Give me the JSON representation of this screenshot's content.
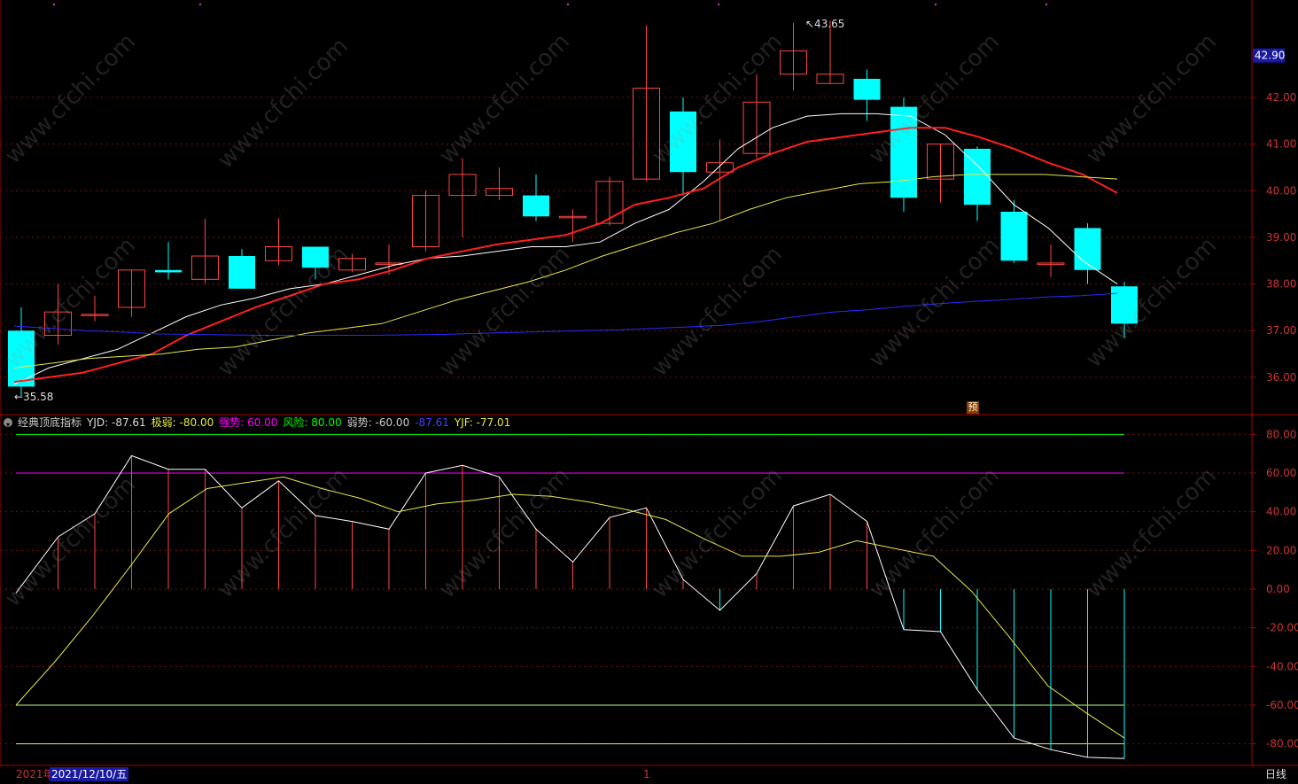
{
  "colors": {
    "background": "#000000",
    "up": "#ff4444",
    "down": "#00ffff",
    "grid": "#7a1010",
    "axis": "#aa0000",
    "ma5": "#ffffff",
    "ma10": "#ff2020",
    "ma20": "#e8e84a",
    "ma60": "#2a2aff",
    "yjd": "#ffffff",
    "yjf": "#e8e84a",
    "strong": "#ff00ff",
    "risk": "#00ff00",
    "weak": "#b0ff80"
  },
  "header": {
    "toggle_icon": "circle-arrow-icon",
    "indicator_name": "经典顶底指标",
    "yjd": "YJD: -87.61",
    "jiruo": "极弱: -80.00",
    "qiangshi": "强势: 60.00",
    "fengxian": "风险: 80.00",
    "ruoshi": "弱势: -60.00",
    "blue_value": "-87.61",
    "yjf": "YJF: -77.01"
  },
  "price_axis": {
    "current_price": "42.90",
    "ticks": [
      "42.00",
      "41.00",
      "40.00",
      "39.00",
      "38.00",
      "37.00",
      "36.00"
    ]
  },
  "indicator_axis": {
    "ticks": [
      "80.00",
      "60.00",
      "40.00",
      "20.00",
      "0.00",
      "-20.00",
      "-40.00",
      "-60.00",
      "-80.00"
    ]
  },
  "annotations": {
    "max_label": "43.65",
    "min_label": "35.58",
    "forecast_badge": "预"
  },
  "bottom": {
    "year_label": "2021年",
    "cursor_date": "2021/12/10/五",
    "month_marker": "1",
    "period_label": "日线"
  },
  "watermark_text": "www.cfchi.com",
  "chart_data": [
    {
      "type": "candlestick",
      "title": "",
      "ylim": [
        35.2,
        43.9
      ],
      "candles": [
        {
          "o": 37.0,
          "h": 37.5,
          "l": 35.6,
          "c": 35.8
        },
        {
          "o": 36.9,
          "h": 38.0,
          "l": 36.7,
          "c": 37.4
        },
        {
          "o": 37.35,
          "h": 37.75,
          "l": 37.2,
          "c": 37.35
        },
        {
          "o": 37.5,
          "h": 38.3,
          "l": 37.3,
          "c": 38.3
        },
        {
          "o": 38.3,
          "h": 38.9,
          "l": 38.1,
          "c": 38.25
        },
        {
          "o": 38.1,
          "h": 39.4,
          "l": 38.0,
          "c": 38.6
        },
        {
          "o": 38.6,
          "h": 38.75,
          "l": 37.9,
          "c": 37.9
        },
        {
          "o": 38.5,
          "h": 39.4,
          "l": 38.4,
          "c": 38.8
        },
        {
          "o": 38.8,
          "h": 38.8,
          "l": 38.1,
          "c": 38.35
        },
        {
          "o": 38.3,
          "h": 38.65,
          "l": 38.25,
          "c": 38.55
        },
        {
          "o": 38.45,
          "h": 38.85,
          "l": 38.2,
          "c": 38.45
        },
        {
          "o": 38.8,
          "h": 40.0,
          "l": 38.7,
          "c": 39.9
        },
        {
          "o": 39.9,
          "h": 40.7,
          "l": 39.0,
          "c": 40.35
        },
        {
          "o": 39.9,
          "h": 40.5,
          "l": 39.8,
          "c": 40.05
        },
        {
          "o": 39.9,
          "h": 40.35,
          "l": 39.35,
          "c": 39.45
        },
        {
          "o": 39.45,
          "h": 39.6,
          "l": 38.9,
          "c": 39.45
        },
        {
          "o": 39.3,
          "h": 40.3,
          "l": 39.25,
          "c": 40.2
        },
        {
          "o": 40.25,
          "h": 43.55,
          "l": 40.2,
          "c": 42.2
        },
        {
          "o": 41.7,
          "h": 42.0,
          "l": 39.9,
          "c": 40.4
        },
        {
          "o": 40.4,
          "h": 41.1,
          "l": 39.35,
          "c": 40.6
        },
        {
          "o": 40.8,
          "h": 42.5,
          "l": 40.7,
          "c": 41.9
        },
        {
          "o": 42.5,
          "h": 43.6,
          "l": 42.15,
          "c": 43.0
        },
        {
          "o": 42.3,
          "h": 43.65,
          "l": 42.3,
          "c": 42.5
        },
        {
          "o": 42.4,
          "h": 42.6,
          "l": 41.5,
          "c": 41.95
        },
        {
          "o": 41.8,
          "h": 42.0,
          "l": 39.55,
          "c": 39.85
        },
        {
          "o": 40.25,
          "h": 41.0,
          "l": 39.75,
          "c": 41.0
        },
        {
          "o": 40.9,
          "h": 40.95,
          "l": 39.35,
          "c": 39.7
        },
        {
          "o": 39.55,
          "h": 39.8,
          "l": 38.45,
          "c": 38.5
        },
        {
          "o": 38.45,
          "h": 38.85,
          "l": 38.15,
          "c": 38.45
        },
        {
          "o": 39.2,
          "h": 39.3,
          "l": 38.0,
          "c": 38.3
        },
        {
          "o": 37.95,
          "h": 38.05,
          "l": 36.85,
          "c": 37.15
        }
      ],
      "ma_series": [
        {
          "key": "ma5",
          "values": [
            35.85,
            36.2,
            36.4,
            36.6,
            36.95,
            37.3,
            37.55,
            37.7,
            37.9,
            38.0,
            38.2,
            38.4,
            38.55,
            38.6,
            38.7,
            38.8,
            38.8,
            38.9,
            39.3,
            39.6,
            40.2,
            40.9,
            41.35,
            41.6,
            41.65,
            41.65,
            41.6,
            41.2,
            40.5,
            39.7,
            39.2,
            38.5,
            38.0
          ]
        },
        {
          "key": "ma10",
          "values": [
            35.9,
            36.0,
            36.1,
            36.3,
            36.5,
            36.9,
            37.2,
            37.5,
            37.75,
            38.0,
            38.1,
            38.3,
            38.55,
            38.7,
            38.85,
            38.95,
            39.05,
            39.3,
            39.7,
            39.85,
            40.05,
            40.5,
            40.8,
            41.05,
            41.15,
            41.25,
            41.35,
            41.35,
            41.15,
            40.9,
            40.6,
            40.35,
            39.95
          ]
        },
        {
          "key": "ma20",
          "values": [
            36.2,
            36.3,
            36.4,
            36.45,
            36.5,
            36.6,
            36.65,
            36.8,
            36.95,
            37.05,
            37.15,
            37.4,
            37.65,
            37.85,
            38.05,
            38.3,
            38.6,
            38.85,
            39.1,
            39.3,
            39.6,
            39.85,
            40.0,
            40.15,
            40.2,
            40.3,
            40.35,
            40.35,
            40.35,
            40.3,
            40.25
          ]
        },
        {
          "key": "ma60",
          "values": [
            37.1,
            37.05,
            37.0,
            36.97,
            36.93,
            36.92,
            36.91,
            36.9,
            36.9,
            36.9,
            36.9,
            36.91,
            36.92,
            36.94,
            36.96,
            36.98,
            37.0,
            37.02,
            37.05,
            37.08,
            37.12,
            37.2,
            37.3,
            37.4,
            37.45,
            37.52,
            37.58,
            37.63,
            37.67,
            37.72,
            37.75,
            37.8
          ]
        }
      ]
    },
    {
      "type": "line",
      "title": "经典顶底指标",
      "ylim": [
        -88,
        88
      ],
      "levels": {
        "fengxian": 80,
        "qiangshi": 60,
        "ruoshi": -60,
        "jiruo": -80
      },
      "yjd": [
        -2,
        27,
        39,
        69,
        62,
        62,
        42,
        56,
        38,
        35,
        31,
        60,
        64,
        58,
        31,
        14,
        37,
        42,
        5,
        -11,
        8,
        43,
        49,
        35,
        -21,
        -22,
        -52,
        -77,
        -83,
        -87,
        -87.61
      ],
      "yjf": [
        -60,
        -38,
        -14,
        12,
        39,
        52,
        55,
        58,
        52,
        47,
        40,
        44,
        46,
        49,
        48,
        45,
        41,
        36,
        26,
        17,
        17,
        19,
        25,
        21,
        17,
        -1,
        -25,
        -50,
        -64,
        -77.01
      ]
    }
  ]
}
